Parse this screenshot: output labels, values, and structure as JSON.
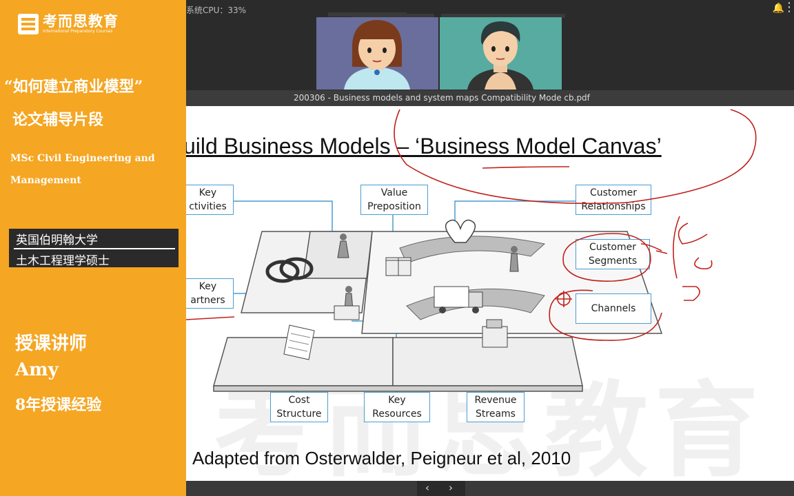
{
  "sidebar": {
    "logo_name": "考而思教育",
    "logo_sub": "International Preparatory Courses",
    "quote_title": "“如何建立商业模型”",
    "subtitle": "论文辅导片段",
    "program": "MSc Civil Engineering and Management",
    "university_line1": "英国伯明翰大学",
    "university_line2": "土木工程理学硕士",
    "lecturer_label": "授课讲师",
    "lecturer_name": "Amy",
    "experience": "8年授课经验"
  },
  "topbar": {
    "cpu": "系统CPU：33%"
  },
  "window": {
    "pdf_title": "200306 - Business models and system maps Compatibility Mode cb.pdf"
  },
  "slide": {
    "heading": "uild Business Models – ‘Business Model Canvas’",
    "citation": "Adapted from Osterwalder, Peigneur et al, 2010",
    "watermark": "考而思教育",
    "labels": {
      "key_activities_1": "Key",
      "key_activities_2": "ctivities",
      "value_prop_1": "Value",
      "value_prop_2": "Preposition",
      "cust_rel_1": "Customer",
      "cust_rel_2": "Relationships",
      "cust_seg_1": "Customer",
      "cust_seg_2": "Segments",
      "key_partners_1": "Key",
      "key_partners_2": "artners",
      "channels": "Channels",
      "cost_1": "Cost",
      "cost_2": "Structure",
      "key_res_1": "Key",
      "key_res_2": "Resources",
      "revenue_1": "Revenue",
      "revenue_2": "Streams"
    }
  },
  "nav": {
    "prev": "‹",
    "next": "›"
  },
  "colors": {
    "sidebar": "#f5a623",
    "label_border": "#4a9cd0",
    "annotation": "#c0201a"
  }
}
